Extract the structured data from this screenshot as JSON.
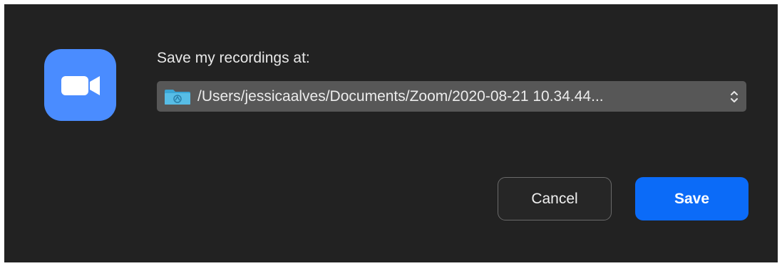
{
  "dialog": {
    "app_icon": "zoom-video-camera-icon",
    "prompt_label": "Save my recordings at:",
    "path_select": {
      "folder_icon": "folder-icon",
      "value": "/Users/jessicaalves/Documents/Zoom/2020-08-21 10.34.44...",
      "stepper_icon": "up-down-chevron-icon"
    },
    "buttons": {
      "cancel_label": "Cancel",
      "save_label": "Save"
    }
  },
  "colors": {
    "dialog_background": "#222222",
    "app_icon_blue": "#4a8cff",
    "select_background": "#575757",
    "primary_button": "#0b6bf8"
  }
}
